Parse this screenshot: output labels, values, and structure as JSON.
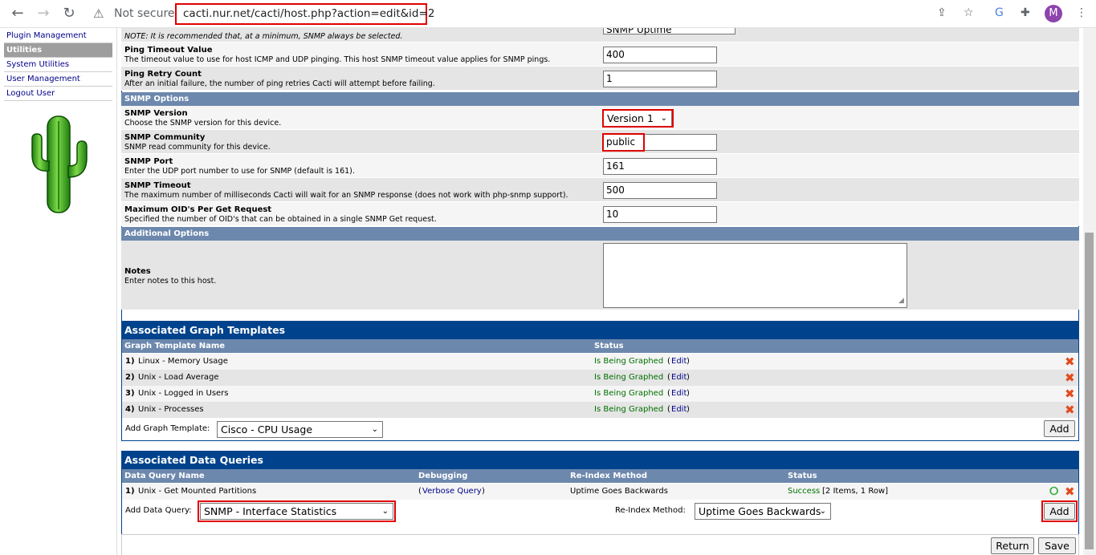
{
  "browser": {
    "back": "←",
    "forward": "→",
    "reload": "↻",
    "security_label": "Not secure",
    "url": "cacti.nur.net/cacti/host.php?action=edit&id=2",
    "avatar_letter": "M"
  },
  "sidebar": {
    "items": [
      "Plugin Management",
      "Utilities",
      "System Utilities",
      "User Management",
      "Logout User"
    ]
  },
  "top_fragment": {
    "description": "NOTE: It is recommended that, at a minimum, SNMP always be selected.",
    "value": "SNMP Uptime"
  },
  "fields": {
    "ping_timeout": {
      "title": "Ping Timeout Value",
      "desc": "The timeout value to use for host ICMP and UDP pinging. This host SNMP timeout value applies for SNMP pings.",
      "value": "400"
    },
    "ping_retry": {
      "title": "Ping Retry Count",
      "desc": "After an initial failure, the number of ping retries Cacti will attempt before failing.",
      "value": "1"
    },
    "snmp_section": "SNMP Options",
    "snmp_version": {
      "title": "SNMP Version",
      "desc": "Choose the SNMP version for this device.",
      "value": "Version 1"
    },
    "snmp_community": {
      "title": "SNMP Community",
      "desc": "SNMP read community for this device.",
      "value": "public"
    },
    "snmp_port": {
      "title": "SNMP Port",
      "desc": "Enter the UDP port number to use for SNMP (default is 161).",
      "value": "161"
    },
    "snmp_timeout": {
      "title": "SNMP Timeout",
      "desc": "The maximum number of milliseconds Cacti will wait for an SNMP response (does not work with php-snmp support).",
      "value": "500"
    },
    "max_oids": {
      "title": "Maximum OID's Per Get Request",
      "desc": "Specified the number of OID's that can be obtained in a single SNMP Get request.",
      "value": "10"
    },
    "additional_section": "Additional Options",
    "notes": {
      "title": "Notes",
      "desc": "Enter notes to this host.",
      "value": ""
    }
  },
  "graph_templates": {
    "title": "Associated Graph Templates",
    "col_name": "Graph Template Name",
    "col_status": "Status",
    "rows": [
      {
        "num": "1)",
        "name": "Linux - Memory Usage",
        "status": "Is Being Graphed",
        "edit": "Edit"
      },
      {
        "num": "2)",
        "name": "Unix - Load Average",
        "status": "Is Being Graphed",
        "edit": "Edit"
      },
      {
        "num": "3)",
        "name": "Unix - Logged in Users",
        "status": "Is Being Graphed",
        "edit": "Edit"
      },
      {
        "num": "4)",
        "name": "Unix - Processes",
        "status": "Is Being Graphed",
        "edit": "Edit"
      }
    ],
    "add_label": "Add Graph Template:",
    "add_select": "Cisco - CPU Usage",
    "add_button": "Add"
  },
  "data_queries": {
    "title": "Associated Data Queries",
    "col_name": "Data Query Name",
    "col_debug": "Debugging",
    "col_reindex": "Re-Index Method",
    "col_status": "Status",
    "rows": [
      {
        "num": "1)",
        "name": "Unix - Get Mounted Partitions",
        "debug_link": "Verbose Query",
        "reindex": "Uptime Goes Backwards",
        "status": "Success",
        "status_extra": "[2 Items, 1 Row]"
      }
    ],
    "add_label": "Add Data Query:",
    "add_select": "SNMP - Interface Statistics",
    "reindex_label": "Re-Index Method:",
    "reindex_select": "Uptime Goes Backwards",
    "add_button": "Add"
  },
  "footer": {
    "return_button": "Return",
    "save_button": "Save"
  },
  "colors": {
    "header_blue": "#00438c",
    "section_blue": "#6d88ad",
    "highlight_red": "#e00000",
    "status_green": "#007000"
  }
}
